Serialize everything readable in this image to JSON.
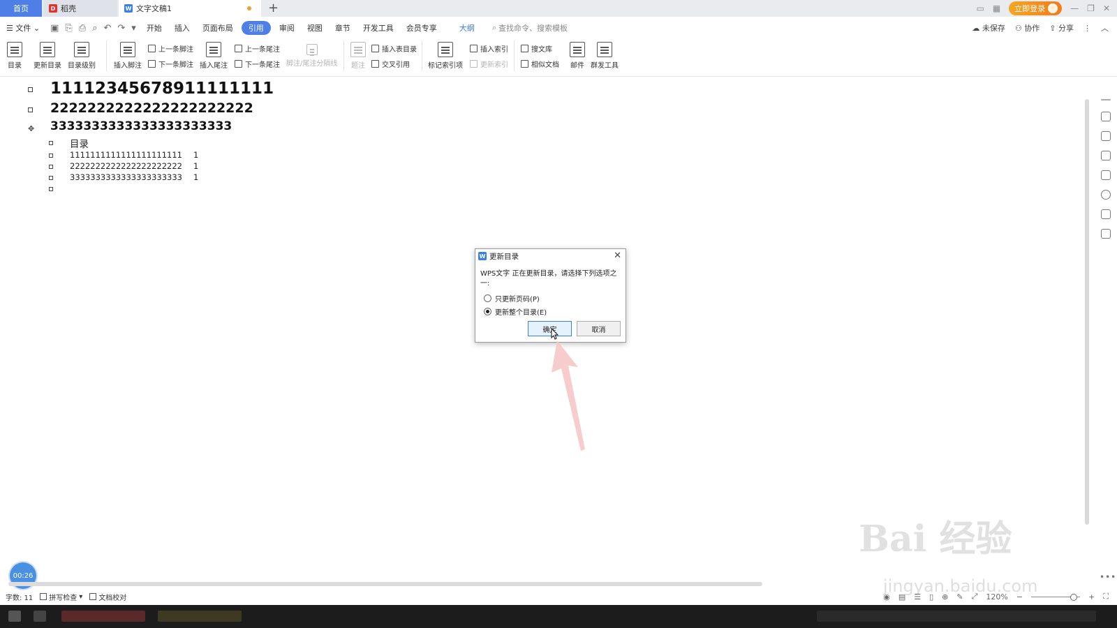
{
  "tabs": {
    "home": "首页",
    "daoke": "稻壳",
    "doc": "文字文稿1",
    "add": "+"
  },
  "titlebar": {
    "login": "立即登录"
  },
  "menu": {
    "file": "文件",
    "items": [
      "开始",
      "插入",
      "页面布局",
      "引用",
      "审阅",
      "视图",
      "章节",
      "开发工具",
      "会员专享"
    ],
    "active": "引用",
    "outline": "大纲",
    "search": "查找命令、搜索模板",
    "unsaved": "未保存",
    "collab": "协作",
    "share": "分享"
  },
  "ribbon": {
    "toc": "目录",
    "update_toc": "更新目录",
    "toc_level": "目录级别",
    "insert_footnote": "插入脚注",
    "prev_footnote": "上一条脚注",
    "next_footnote": "下一条脚注",
    "insert_endnote": "插入尾注",
    "prev_endnote": "上一条尾注",
    "next_endnote": "下一条尾注",
    "note_separator": "脚注/尾注分隔线",
    "caption": "题注",
    "insert_table_of_figures": "插入表目录",
    "cross_reference": "交叉引用",
    "mark_index": "标记索引项",
    "insert_index": "插入索引",
    "update_index": "更新索引",
    "search_library": "搜文库",
    "similar_docs": "相似文档",
    "mail": "邮件",
    "mass_send": "群发工具"
  },
  "document": {
    "headings": [
      "11112345678911111111",
      "2222222222222222222222",
      "3333333333333333333333"
    ],
    "toc_title": "目录",
    "toc_entries": [
      {
        "text": "1111111111111111111111",
        "page": "1"
      },
      {
        "text": "2222222222222222222222",
        "page": "1"
      },
      {
        "text": "3333333333333333333333",
        "page": "1"
      }
    ]
  },
  "dialog": {
    "title": "更新目录",
    "message": "WPS文字 正在更新目录，请选择下列选项之一:",
    "option_page_only": "只更新页码(P)",
    "option_entire": "更新整个目录(E)",
    "selected": "option_entire",
    "ok": "确定",
    "cancel": "取消"
  },
  "status": {
    "word_count": "字数: 11",
    "spell_check": "拼写检查",
    "proofread": "文档校对",
    "zoom": "120%"
  },
  "timer": "00:26",
  "watermark": {
    "brand": "Bai 经验",
    "url": "jingyan.baidu.com"
  },
  "colors": {
    "accent": "#4e7fe6",
    "login": "#f5a623",
    "arrow": "#f6c7c7"
  }
}
